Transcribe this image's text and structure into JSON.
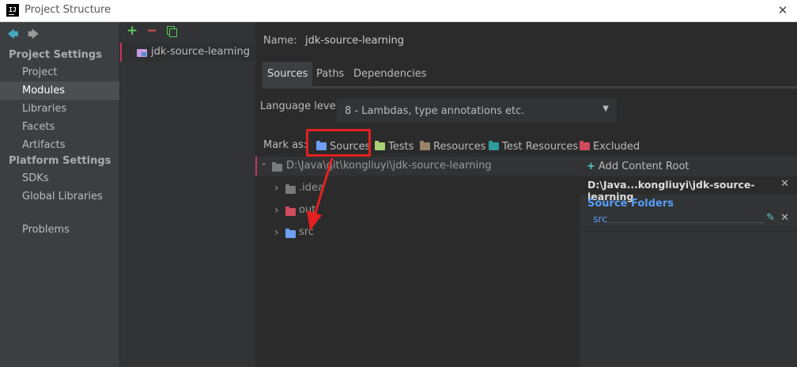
{
  "window": {
    "logo_text": "IJ",
    "title": "Project Structure",
    "close_glyph": "✕"
  },
  "nav": {
    "back_glyph": "🡄",
    "forward_glyph": "🡆",
    "project_settings_header": "Project Settings",
    "project_settings_items": [
      "Project",
      "Modules",
      "Libraries",
      "Facets",
      "Artifacts"
    ],
    "platform_settings_header": "Platform Settings",
    "platform_settings_items": [
      "SDKs",
      "Global Libraries"
    ],
    "problems": "Problems",
    "selected_item": "Modules"
  },
  "modules": {
    "add_glyph": "+",
    "remove_glyph": "−",
    "items": [
      "jdk-source-learning"
    ]
  },
  "main": {
    "name_label": "Name:",
    "name_value": "jdk-source-learning",
    "tabs": [
      "Sources",
      "Paths",
      "Dependencies"
    ],
    "active_tab": "Sources",
    "language_level_label": "Language level:",
    "language_level_value": "8 - Lambdas, type annotations etc.",
    "dropdown_glyph": "▼",
    "mark_as_label": "Mark as:",
    "mark_as_buttons": [
      {
        "label": "Sources",
        "color": "#6e9ff5"
      },
      {
        "label": "Tests",
        "color": "#a9d274"
      },
      {
        "label": "Resources",
        "color": "#9a8368"
      },
      {
        "label": "Test Resources",
        "color": "#2e9c9c"
      },
      {
        "label": "Excluded",
        "color": "#d14b5f"
      }
    ]
  },
  "tree": {
    "chevron_expanded": "⌄",
    "chevron_collapsed": "›",
    "root": {
      "label": "D:\\Java\\git\\kongliuyi\\jdk-source-learning",
      "color": "#7a7a7a"
    },
    "children": [
      {
        "label": ".idea",
        "color": "#7a7a7a"
      },
      {
        "label": "out",
        "color": "#d14b5f"
      },
      {
        "label": "src",
        "color": "#6e9ff5"
      }
    ]
  },
  "content_root_panel": {
    "add_glyph": "+",
    "add_label": "Add Content Root",
    "root_path": "D:\\Java...kongliuyi\\jdk-source-learning",
    "remove_glyph": "✕",
    "source_folders_title": "Source Folders",
    "source_folders": [
      "src"
    ],
    "edit_glyph": "✎"
  },
  "colors": {
    "accent_teal": "#40a9bf",
    "highlight_red": "#e3201f",
    "selection_bar": "#c7385f",
    "link_blue": "#589df6"
  }
}
